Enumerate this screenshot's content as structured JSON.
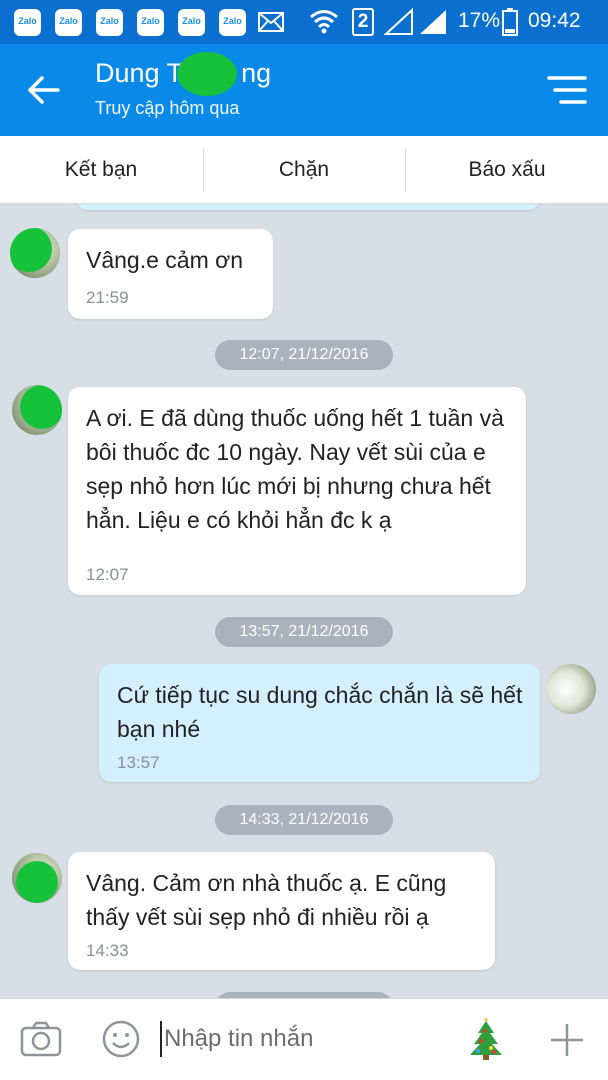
{
  "status_bar": {
    "app_icon_label": "Zalo",
    "sim_number": "2",
    "battery": "17%",
    "time": "09:42"
  },
  "header": {
    "contact_name_start": "Dung T",
    "contact_name_end": "ng",
    "last_seen": "Truy cập hôm qua"
  },
  "actions": {
    "add_friend": "Kết bạn",
    "block": "Chặn",
    "report": "Báo xấu"
  },
  "messages": [
    {
      "from": "them",
      "text": "Vâng.e cảm ơn",
      "time": "21:59"
    },
    {
      "type": "date",
      "text": "12:07, 21/12/2016"
    },
    {
      "from": "them",
      "text": "A ơi. E đã dùng thuốc uống hết 1 tuần và bôi thuốc đc 10 ngày. Nay vết sùi của e sẹp nhỏ hơn lúc mới bị nhưng chưa hết hẳn. Liệu e có khỏi hẳn đc k ạ",
      "time": "12:07"
    },
    {
      "type": "date",
      "text": "13:57, 21/12/2016"
    },
    {
      "from": "me",
      "text": "Cứ tiếp tục su dung chắc chắn là sẽ hết bạn nhé",
      "time": "13:57"
    },
    {
      "type": "date",
      "text": "14:33, 21/12/2016"
    },
    {
      "from": "them",
      "text": "Vâng. Cảm ơn nhà thuốc ạ. E cũng thấy vết sùi sẹp nhỏ đi nhiều rồi ạ",
      "time": "14:33"
    }
  ],
  "input": {
    "placeholder": "Nhập tin nhắn"
  },
  "colors": {
    "status_bar": "#0a6fcf",
    "header": "#0a8ae8",
    "chat_bg": "#d7dfe6",
    "my_bubble": "#d4efff",
    "date_pill": "#a8b3bd"
  },
  "icons": [
    "zalo-icon",
    "mail-icon",
    "wifi-icon",
    "signal-icon",
    "battery-icon",
    "back-arrow-icon",
    "menu-icon",
    "camera-icon",
    "emoji-icon",
    "tree-sticker-icon",
    "plus-icon"
  ]
}
